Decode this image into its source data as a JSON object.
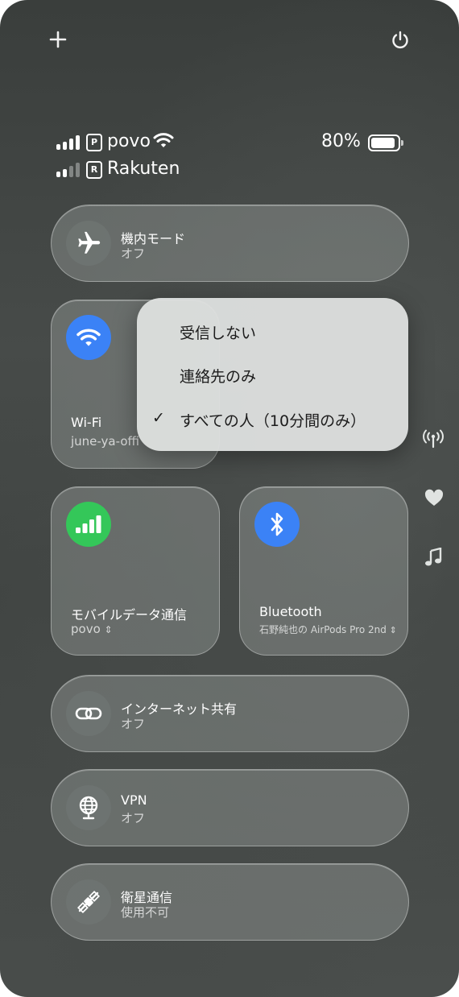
{
  "header": {
    "add_icon": "plus-icon",
    "power_icon": "power-icon"
  },
  "status": {
    "carrier1": "povo",
    "carrier1_sim": "P",
    "carrier2": "Rakuten",
    "carrier2_sim": "R",
    "battery": "80%",
    "battery_level": 0.8
  },
  "tiles": {
    "airplane": {
      "label": "機内モード",
      "sub": "オフ",
      "icon": "airplane-icon"
    },
    "wifi": {
      "label": "Wi-Fi",
      "sub": "june-ya-offi",
      "icon": "wifi-icon"
    },
    "mobile": {
      "label": "モバイルデータ通信",
      "sub": "povo",
      "icon": "cellular-icon"
    },
    "bluetooth": {
      "label": "Bluetooth",
      "sub": "石野純也の AirPods Pro 2nd",
      "icon": "bluetooth-icon"
    },
    "hotspot": {
      "label": "インターネット共有",
      "sub": "オフ",
      "icon": "link-icon"
    },
    "vpn": {
      "label": "VPN",
      "sub": "オフ",
      "icon": "globe-icon"
    },
    "satellite": {
      "label": "衛星通信",
      "sub": "使用不可",
      "icon": "satellite-icon"
    }
  },
  "airdrop_menu": {
    "options": [
      "受信しない",
      "連絡先のみ",
      "すべての人（10分間のみ）"
    ],
    "selected_index": 2
  },
  "side_icons": [
    "antenna-icon",
    "heart-icon",
    "music-note-icon"
  ]
}
